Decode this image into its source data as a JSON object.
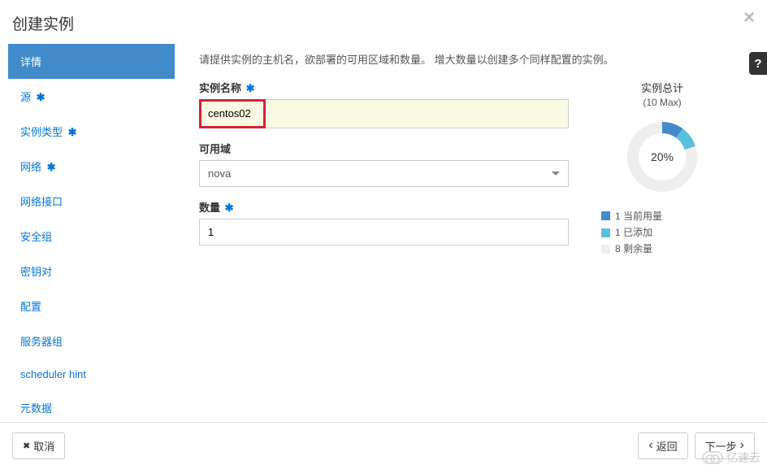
{
  "modal": {
    "title": "创建实例",
    "close_symbol": "×"
  },
  "sidebar": {
    "items": [
      {
        "label": "详情",
        "required": false,
        "active": true
      },
      {
        "label": "源",
        "required": true,
        "active": false
      },
      {
        "label": "实例类型",
        "required": true,
        "active": false
      },
      {
        "label": "网络",
        "required": true,
        "active": false
      },
      {
        "label": "网络接口",
        "required": false,
        "active": false
      },
      {
        "label": "安全组",
        "required": false,
        "active": false
      },
      {
        "label": "密钥对",
        "required": false,
        "active": false
      },
      {
        "label": "配置",
        "required": false,
        "active": false
      },
      {
        "label": "服务器组",
        "required": false,
        "active": false
      },
      {
        "label": "scheduler hint",
        "required": false,
        "active": false
      },
      {
        "label": "元数据",
        "required": false,
        "active": false
      }
    ]
  },
  "form": {
    "description": "请提供实例的主机名，欲部署的可用区域和数量。 增大数量以创建多个同样配置的实例。",
    "name_label": "实例名称",
    "name_value": "centos02",
    "zone_label": "可用域",
    "zone_value": "nova",
    "count_label": "数量",
    "count_value": "1"
  },
  "summary": {
    "title": "实例总计",
    "max_label": "(10 Max)",
    "percent": "20%",
    "legend_current": "1 当前用量",
    "legend_added": "1 已添加",
    "legend_remaining": "8 剩余量"
  },
  "chart_data": {
    "type": "pie",
    "title": "实例总计",
    "max": 10,
    "series": [
      {
        "name": "当前用量",
        "value": 1,
        "color": "#428bca"
      },
      {
        "name": "已添加",
        "value": 1,
        "color": "#5bc0de"
      },
      {
        "name": "剩余量",
        "value": 8,
        "color": "#eeeeee"
      }
    ],
    "center_label": "20%"
  },
  "footer": {
    "cancel_label": "取消",
    "back_label": "返回",
    "next_label": "下一步"
  },
  "help_symbol": "?",
  "watermark_text": "亿速云",
  "asterisk": "✱",
  "chevron_left": "‹",
  "chevron_right": "›",
  "x_symbol": "✖"
}
